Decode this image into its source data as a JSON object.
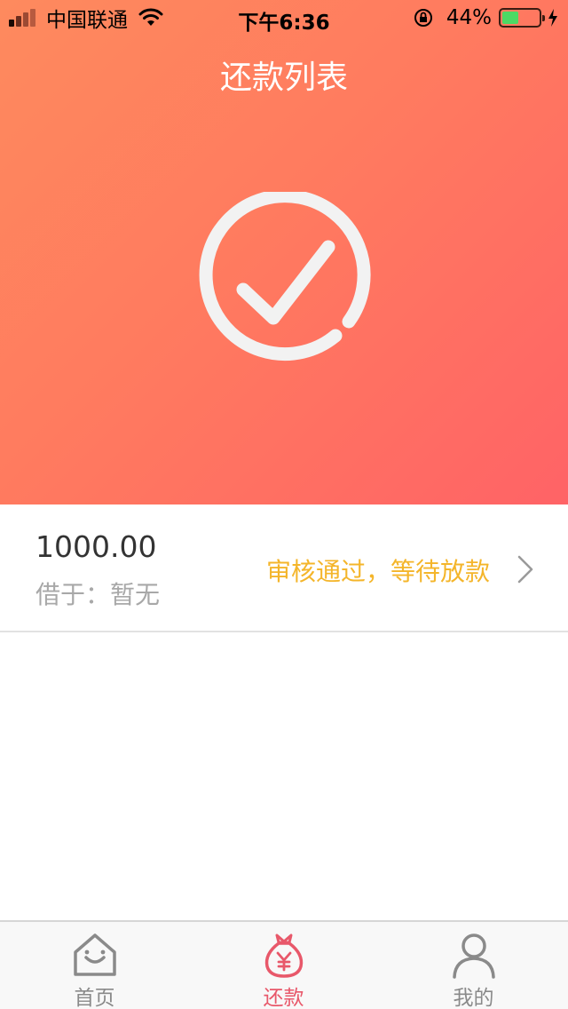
{
  "status_bar": {
    "carrier": "中国联通",
    "time": "下午6:36",
    "battery_percent": "44%",
    "battery_level": 0.44,
    "icons": [
      "signal-icon",
      "wifi-icon",
      "orientation-lock-icon",
      "battery-icon",
      "charging-icon"
    ]
  },
  "nav": {
    "title": "还款列表"
  },
  "hero": {
    "icon": "check-circle-icon"
  },
  "loans": [
    {
      "amount": "1000.00",
      "lender_label": "借于：",
      "lender_value": "暂无",
      "status": "审核通过，等待放款"
    }
  ],
  "tabs": [
    {
      "label": "首页",
      "icon": "home-icon",
      "active": false
    },
    {
      "label": "还款",
      "icon": "money-bag-icon",
      "active": true
    },
    {
      "label": "我的",
      "icon": "user-icon",
      "active": false
    }
  ],
  "colors": {
    "gradient_start": "#fe8a5e",
    "gradient_end": "#ff6366",
    "status_pending": "#f4b52a",
    "tab_active": "#e8586a",
    "tab_inactive": "#8a8a8a",
    "battery": "#4cd964"
  }
}
